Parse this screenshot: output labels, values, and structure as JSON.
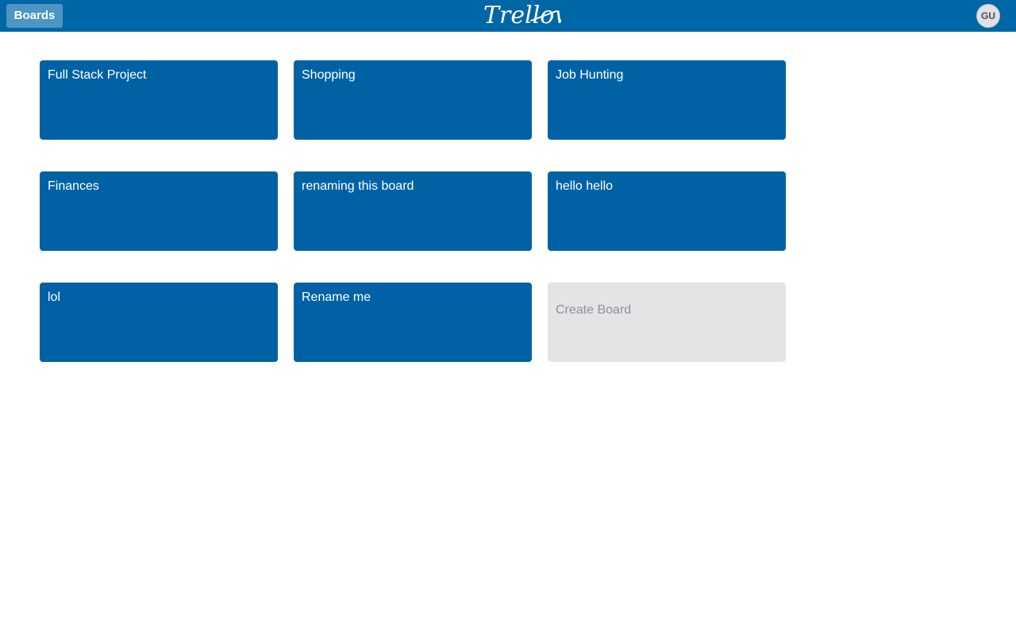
{
  "header": {
    "boards_label": "Boards",
    "logo_text": "Trellow",
    "avatar_initials": "GU"
  },
  "boards": [
    {
      "title": "Full Stack Project"
    },
    {
      "title": "Shopping"
    },
    {
      "title": "Job Hunting"
    },
    {
      "title": "Finances"
    },
    {
      "title": "renaming this board"
    },
    {
      "title": "hello hello"
    },
    {
      "title": "lol"
    },
    {
      "title": "Rename me"
    }
  ],
  "create_board": {
    "label": "Create Board"
  },
  "colors": {
    "header_bg": "#0067a7",
    "board_tile": "#0062a5",
    "create_tile": "#e2e4e6",
    "create_text": "#8c9398"
  }
}
